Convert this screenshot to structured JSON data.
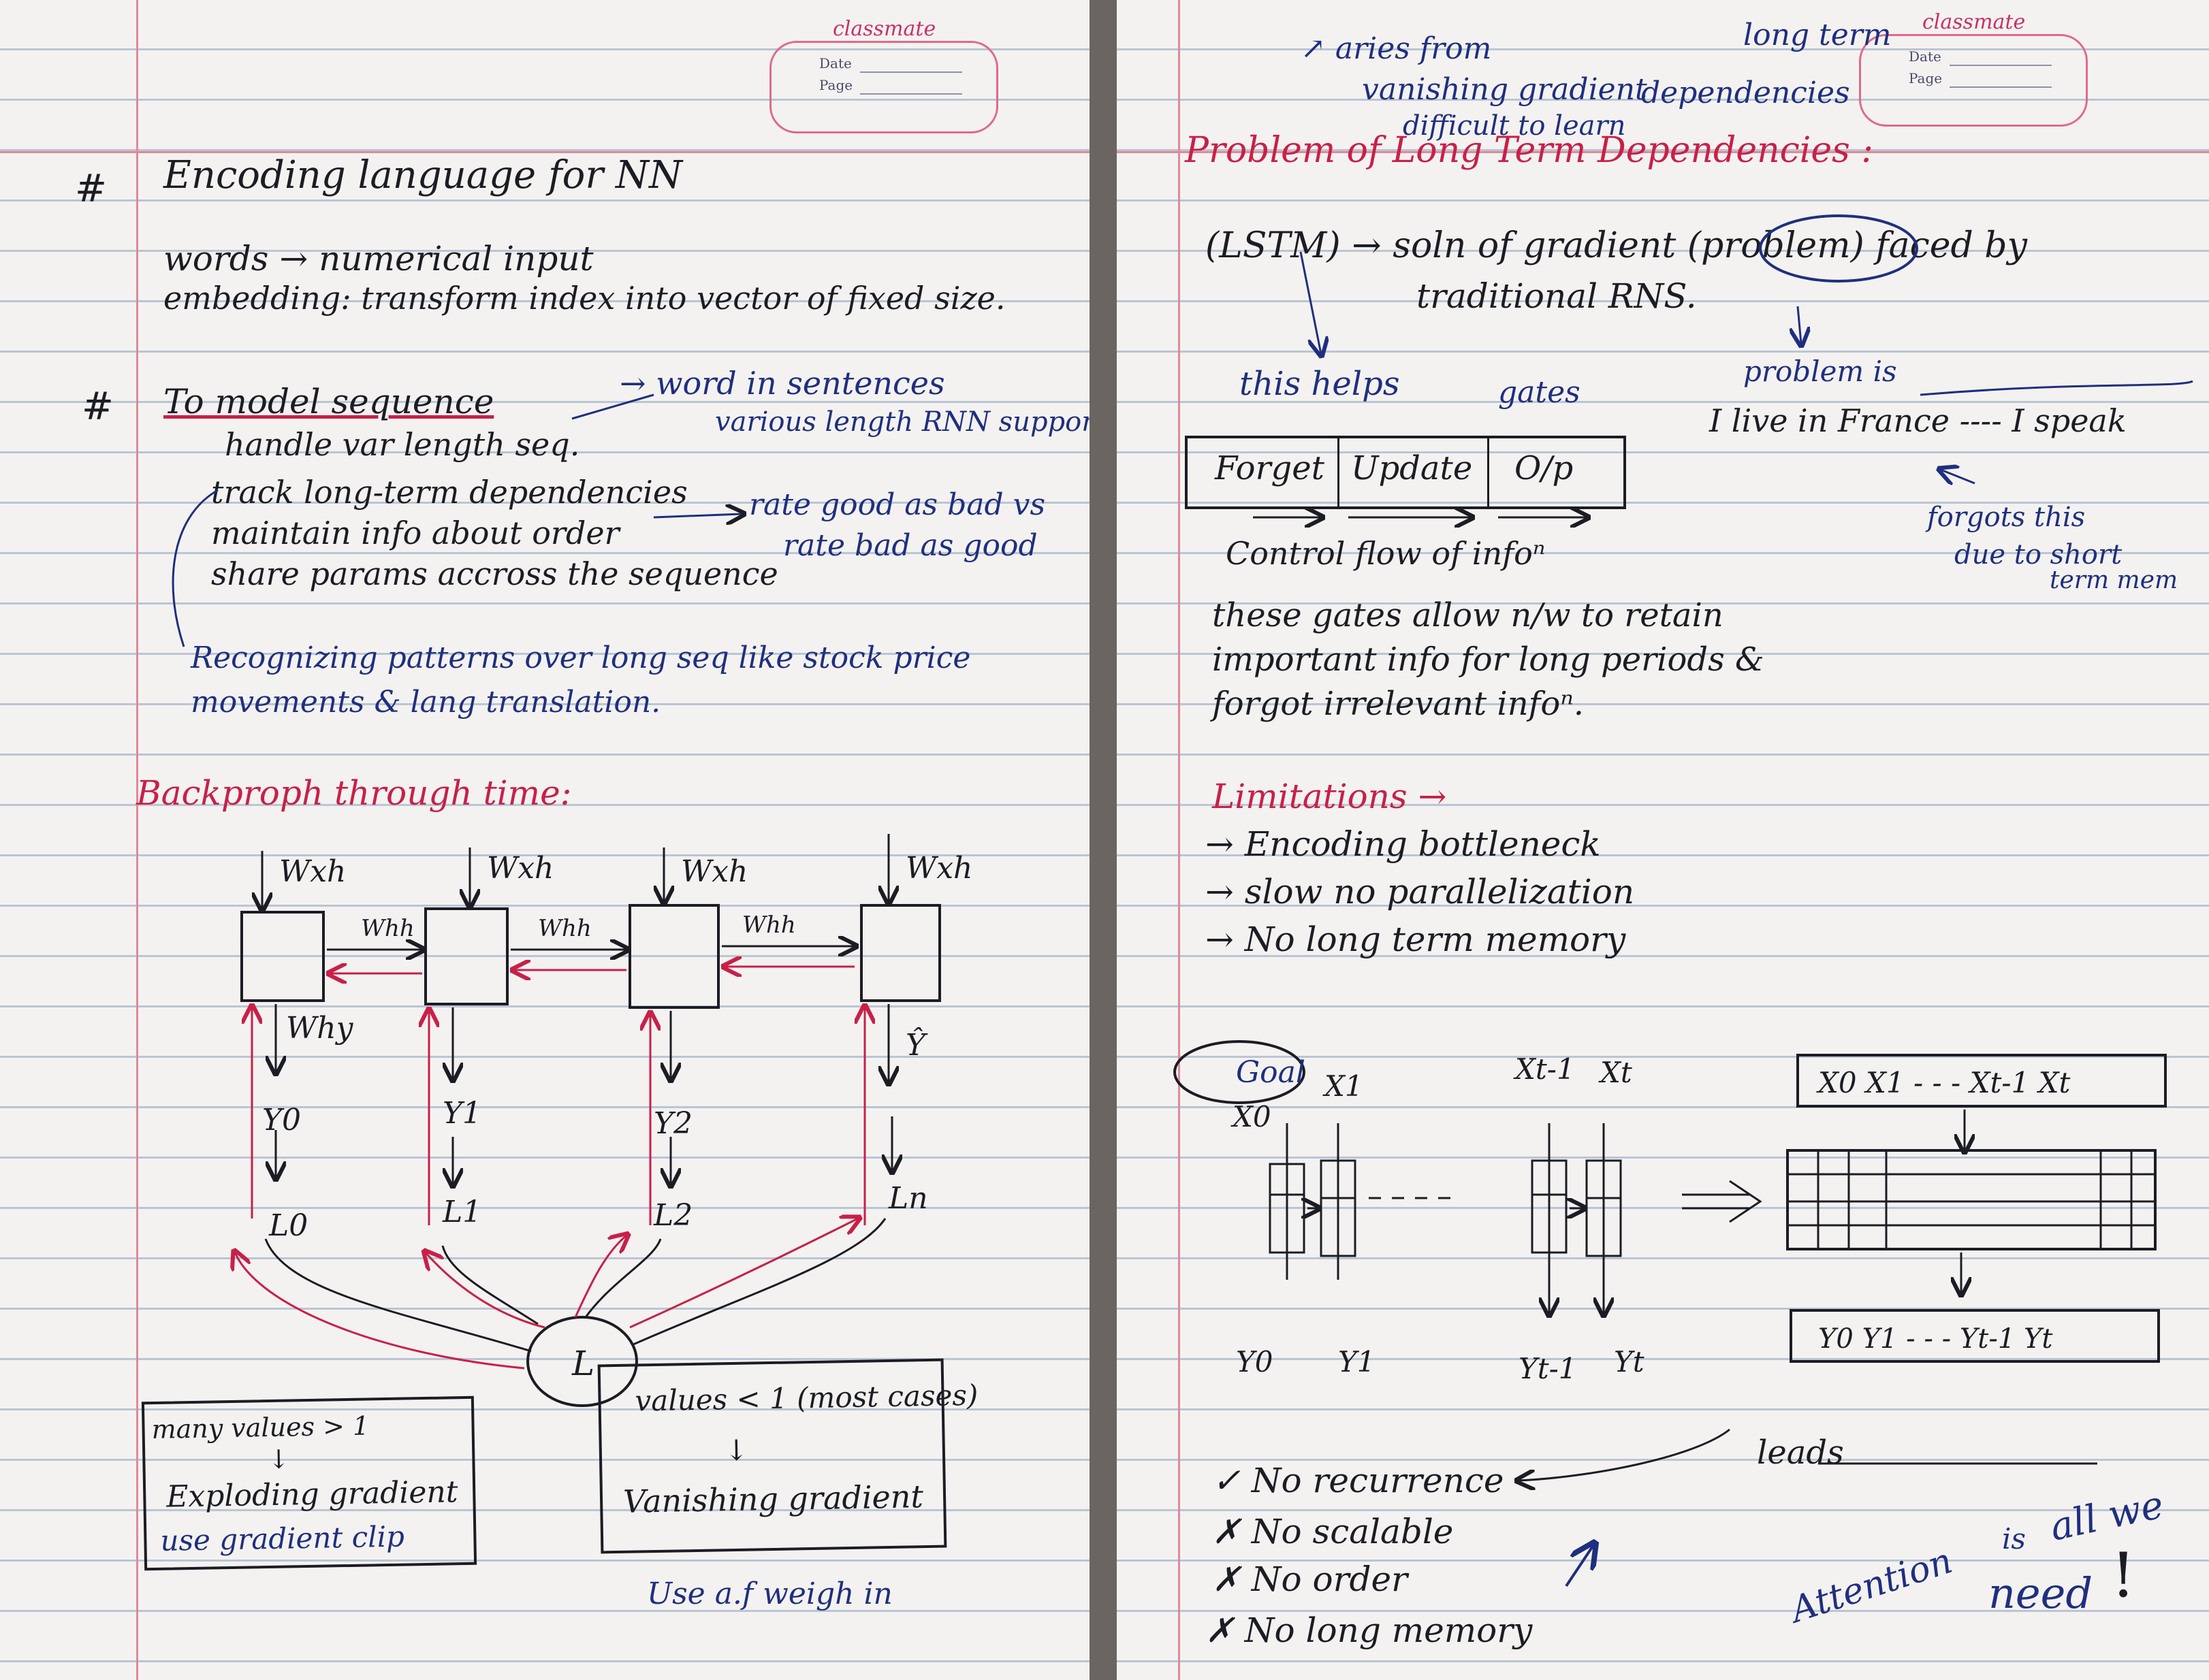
{
  "stamp": {
    "brand": "classmate",
    "date_label": "Date",
    "page_label": "Page"
  },
  "left": {
    "heading1_hash": "#",
    "heading1": "Encoding language for NN",
    "words_line": "words → numerical input",
    "embedding_line": "embedding: transform index into vector of fixed size.",
    "heading2_hash": "#",
    "heading2": "To model sequence",
    "bullets": [
      "handle var length seq.",
      "track long-term dependencies",
      "maintain info about order",
      "share params accross the sequence"
    ],
    "note_words": "→ word in sentences",
    "note_various": "various length RNN supports",
    "note_rate1": "rate good as bad vs",
    "note_rate2": "rate bad as good",
    "recognizing1": "Recognizing patterns over long seq like stock price",
    "recognizing2": "movements & lang translation.",
    "bptt_title": "Backproph through time:",
    "diagram": {
      "wxh": "Wxh",
      "whh": "Whh",
      "why": "Why",
      "outputs": [
        "Y0",
        "Y1",
        "Y2",
        "Ŷ"
      ],
      "losses": [
        "L0",
        "L1",
        "L2",
        "Ln"
      ],
      "total_loss": "L"
    },
    "box_exploding": [
      "many values > 1",
      "↓",
      "Exploding gradient",
      "use gradient clip"
    ],
    "box_vanishing": [
      "values < 1 (most cases)",
      "↓",
      "Vanishing gradient"
    ],
    "vanishing_note": "Use a.f weigh in"
  },
  "right": {
    "top_note1": "↗ aries from",
    "top_note2": "vanishing gradient",
    "top_note3": "difficult to learn",
    "top_note4": "long term",
    "top_note5": "dependencies",
    "title": "Problem of Long Term Dependencies :",
    "lstm_line1": "(LSTM) → soln of gradient (problem) faced by",
    "lstm_line2": "traditional RNS.",
    "this_helps": "this helps",
    "gates_label": "gates",
    "gates": [
      "Forget",
      "Update",
      "O/p"
    ],
    "control_flow": "Control flow of infoⁿ",
    "problem_is": "problem is",
    "problem_example": "I live in France ---- I speak",
    "forgots1": "forgots this",
    "forgots2": "due to short",
    "forgots3": "term mem",
    "gates_para": [
      "these gates allow n/w to retain",
      "important info for long periods &",
      "forgot irrelevant infoⁿ."
    ],
    "limitations_title": "Limitations →",
    "limitations": [
      "→ Encoding bottleneck",
      "→ slow no parallelization",
      "→ No long term memory"
    ],
    "goal": "Goal",
    "diag_inputs": [
      "X0",
      "X1",
      "Xt-1",
      "Xt"
    ],
    "diag_outputs": [
      "Y0",
      "Y1",
      "Yt-1",
      "Yt"
    ],
    "seq_in": "X0  X1 - - -  Xt-1  Xt",
    "seq_out": "Y0  Y1 - - -  Yt-1  Yt",
    "leads": "leads",
    "checklist": [
      "✓ No recurrence",
      "✗ No scalable",
      "✗ No order",
      "✗ No long memory"
    ],
    "attention_1": "Attention",
    "attention_2": "is",
    "attention_3": "all we",
    "attention_4": "need",
    "attention_5": "!"
  },
  "colors": {
    "ink": "#1c1c24",
    "blue_ink": "#1f2f80",
    "red_ink": "#c82048",
    "ruled": "#b9c6d4",
    "margin": "#e08a9a"
  }
}
